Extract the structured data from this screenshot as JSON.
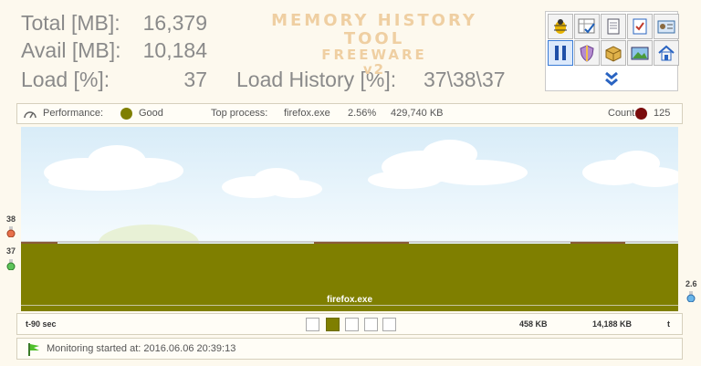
{
  "stats": {
    "total_label": "Total [MB]:",
    "total_value": "16,379",
    "avail_label": "Avail [MB]:",
    "avail_value": "10,184",
    "load_label": "Load [%]:",
    "load_value": "37",
    "load_history_label": "Load History [%]:",
    "load_history_value": "37\\38\\37"
  },
  "brand": {
    "line1": "MEMORY HISTORY TOOL",
    "line2": "FREEWARE",
    "line3": "v2"
  },
  "toolbar": {
    "buttons": [
      {
        "icon": "bug-icon"
      },
      {
        "icon": "grid-check-icon"
      },
      {
        "icon": "document-icon"
      },
      {
        "icon": "checklist-icon"
      },
      {
        "icon": "id-card-icon"
      },
      {
        "icon": "pause-icon",
        "active": true
      },
      {
        "icon": "shield-icon"
      },
      {
        "icon": "package-icon"
      },
      {
        "icon": "image-icon"
      },
      {
        "icon": "home-icon"
      }
    ],
    "expand_icon": "double-chevron-down-icon"
  },
  "performance": {
    "label": "Performance:",
    "value": "Good",
    "status_color": "#7f7f00",
    "top_process_label": "Top process:",
    "top_process_name": "firefox.exe",
    "top_process_percent": "2.56%",
    "top_process_size": "429,740 KB",
    "count_label": "Count:",
    "count_value": "125",
    "count_color": "#7a0b0b"
  },
  "graph": {
    "left_top_value": "38",
    "left_bottom_value": "37",
    "right_value": "2.6",
    "process_label": "firefox.exe",
    "fill_color": "#7f7f00",
    "history_percent": [
      37,
      38,
      37
    ]
  },
  "timebar": {
    "start_label": "t-90 sec",
    "value1": "458 KB",
    "value2": "14,188 KB",
    "end_label": "t",
    "toggles": [
      false,
      true,
      false,
      false,
      false
    ]
  },
  "status": {
    "text": "Monitoring started at: 2016.06.06 20:39:13",
    "icon": "flag-icon"
  }
}
